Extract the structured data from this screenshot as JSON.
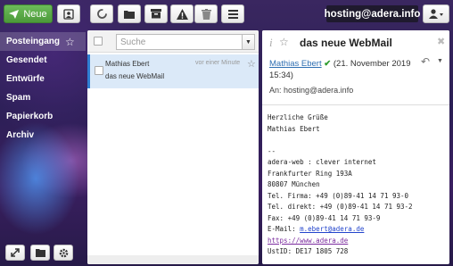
{
  "toolbar": {
    "new_label": "Neue",
    "icons": [
      "compose-icon",
      "contacts-icon",
      "refresh-icon",
      "folder-icon",
      "archive-icon",
      "spam-icon",
      "trash-icon",
      "menu-icon",
      "user-icon"
    ],
    "accent": "#5aaa48"
  },
  "account": {
    "email": "hosting@adera.info"
  },
  "sidebar": {
    "items": [
      {
        "label": "Posteingang",
        "active": true
      },
      {
        "label": "Gesendet"
      },
      {
        "label": "Entwürfe"
      },
      {
        "label": "Spam"
      },
      {
        "label": "Papierkorb"
      },
      {
        "label": "Archiv"
      }
    ]
  },
  "list": {
    "search_placeholder": "Suche",
    "messages": [
      {
        "from": "Mathias Ebert",
        "time": "vor einer Minute",
        "subject": "das neue WebMail"
      }
    ]
  },
  "preview": {
    "subject": "das neue WebMail",
    "sender_name": "Mathias Ebert",
    "date": "(21. November 2019 15:34)",
    "to": "An: hosting@adera.info",
    "body": {
      "lines": [
        "Herzliche Grüße",
        "Mathias Ebert",
        "",
        "--",
        "adera-web : clever internet",
        "Frankfurter Ring 193A",
        "80807 München",
        "Tel. Firma: +49 (0)89-41 14 71 93-0",
        "Tel. direkt: +49 (0)89-41 14 71 93-2",
        "Fax: +49 (0)89-41 14 71 93-9"
      ],
      "email_label": "E-Mail: ",
      "email_link": "m.ebert@adera.de",
      "web_link": "https://www.adera.de",
      "ustid": "UstID: DE17 1805 728"
    }
  }
}
